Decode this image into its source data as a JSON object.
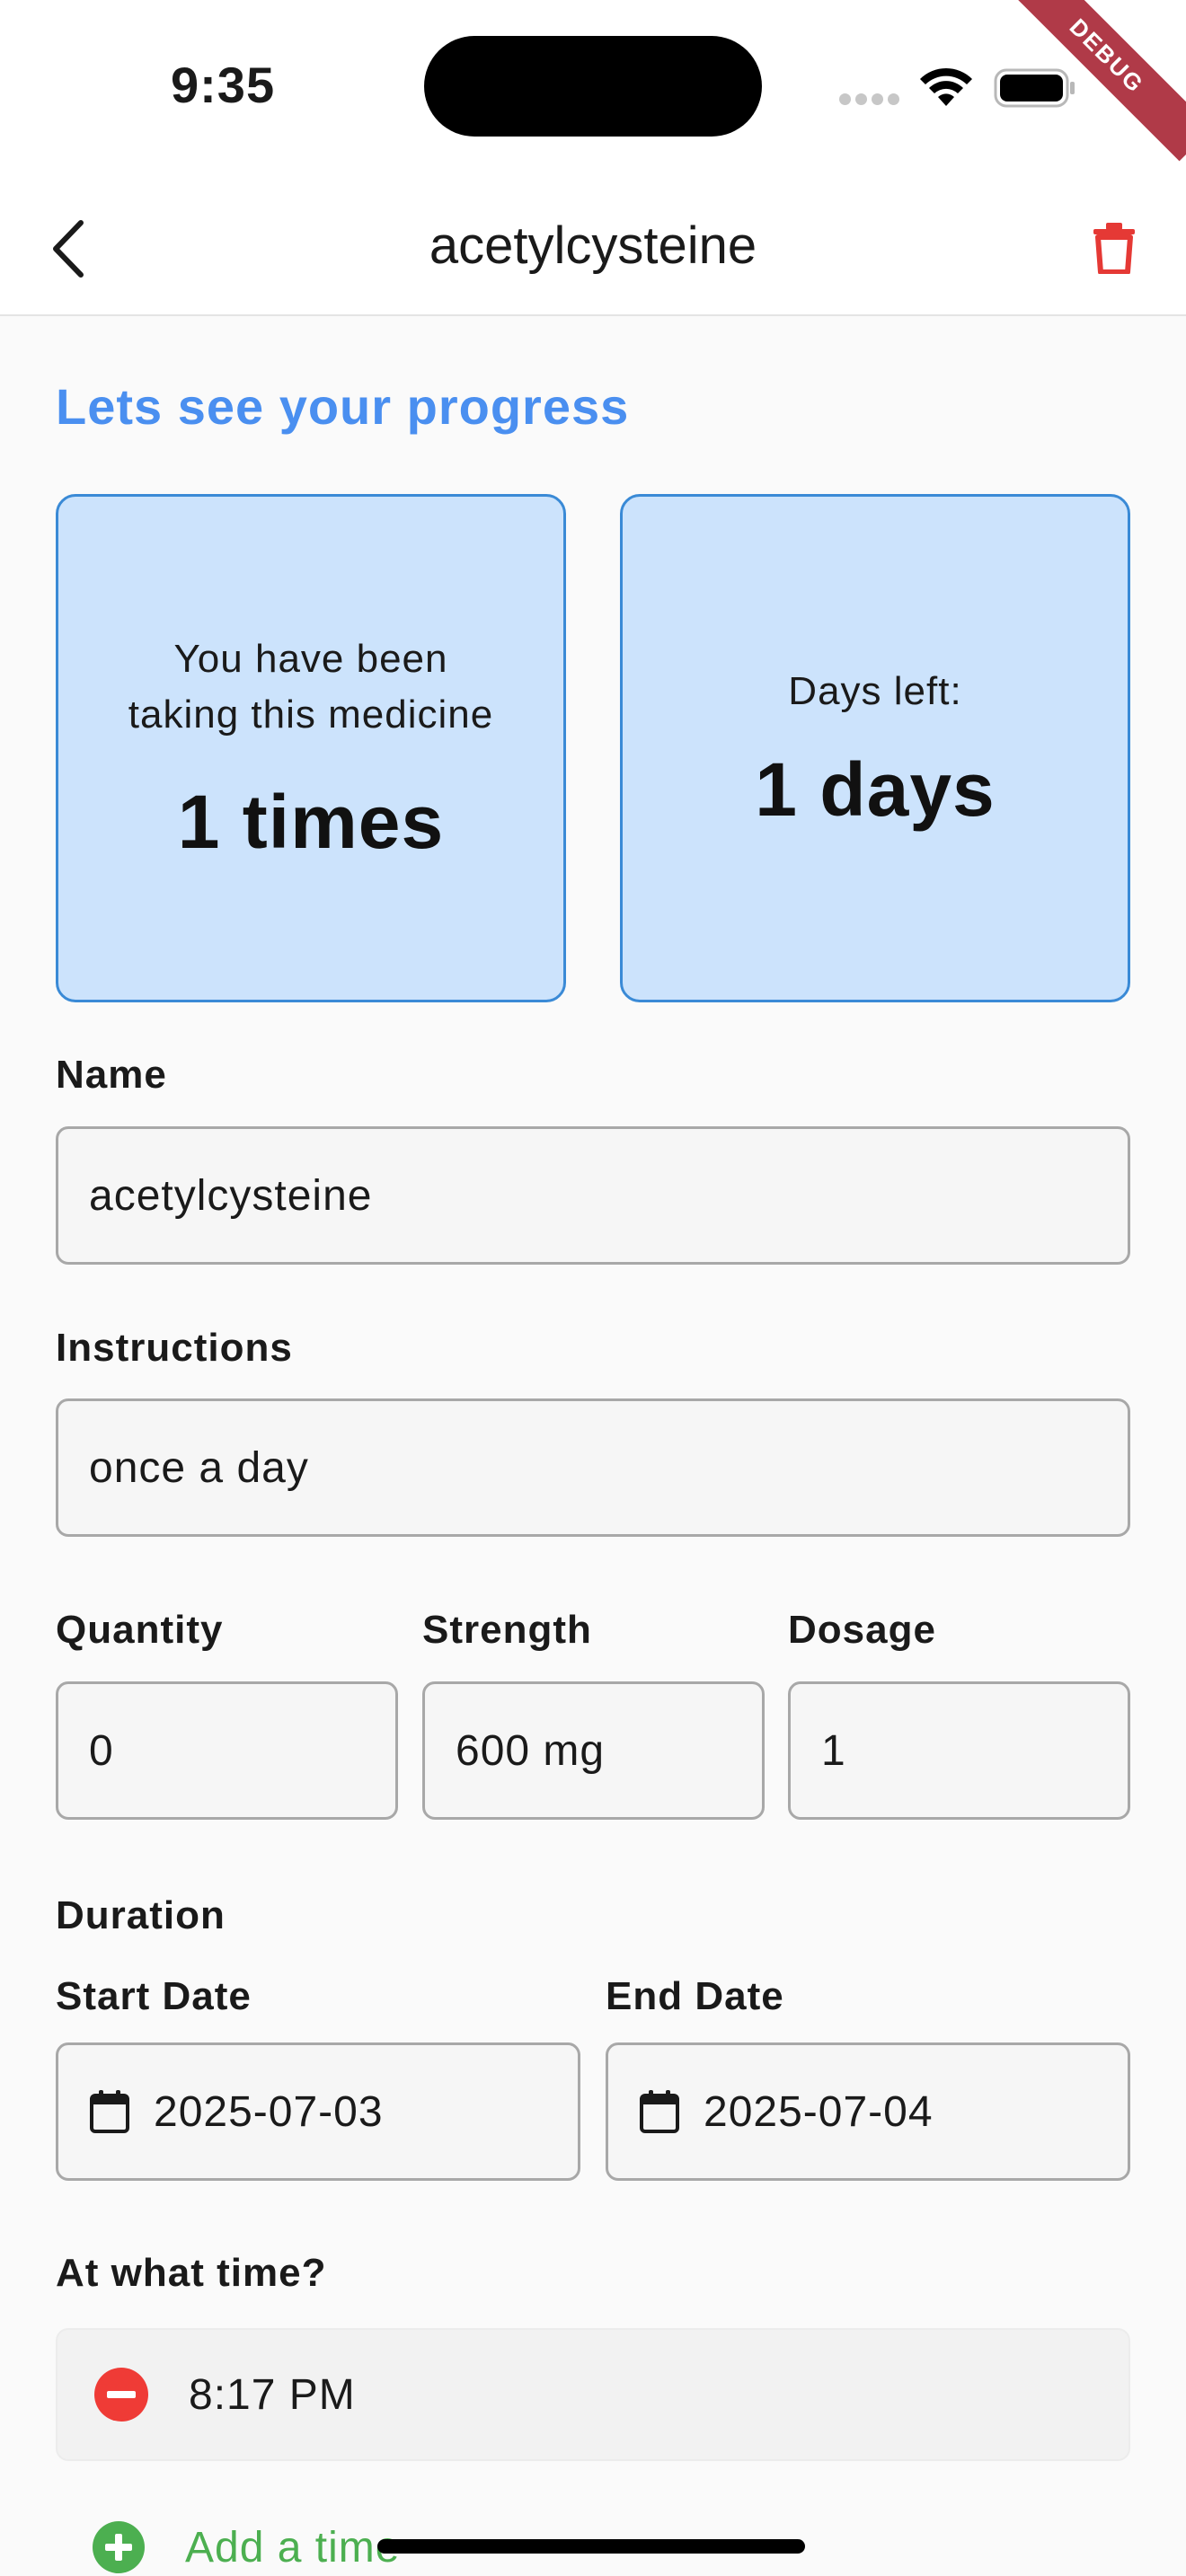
{
  "status_bar": {
    "time": "9:35",
    "debug_label": "DEBUG"
  },
  "app_bar": {
    "title": "acetylcysteine"
  },
  "progress": {
    "heading": "Lets see your progress",
    "taken_label_line1": "You have been",
    "taken_label_line2": "taking this medicine",
    "taken_value": "1 times",
    "days_left_label": "Days left:",
    "days_left_value": "1 days"
  },
  "form": {
    "name": {
      "label": "Name",
      "value": "acetylcysteine"
    },
    "instructions": {
      "label": "Instructions",
      "value": "once a day"
    },
    "quantity": {
      "label": "Quantity",
      "value": "0"
    },
    "strength": {
      "label": "Strength",
      "value": "600 mg"
    },
    "dosage": {
      "label": "Dosage",
      "value": "1"
    },
    "duration": {
      "label": "Duration",
      "start_label": "Start Date",
      "start_value": "2025-07-03",
      "end_label": "End Date",
      "end_value": "2025-07-04"
    },
    "times": {
      "label": "At what time?",
      "items": [
        "8:17 PM"
      ],
      "add_label": "Add a time"
    }
  },
  "colors": {
    "accent": "#4a8ff0",
    "card_bg": "#cce3fc",
    "card_border": "#3a8ad6",
    "delete": "#e53935",
    "add": "#4caf50"
  },
  "icons": [
    "back-chevron-icon",
    "trash-icon",
    "calendar-icon",
    "remove-circle-icon",
    "add-circle-icon",
    "wifi-icon",
    "battery-icon"
  ]
}
